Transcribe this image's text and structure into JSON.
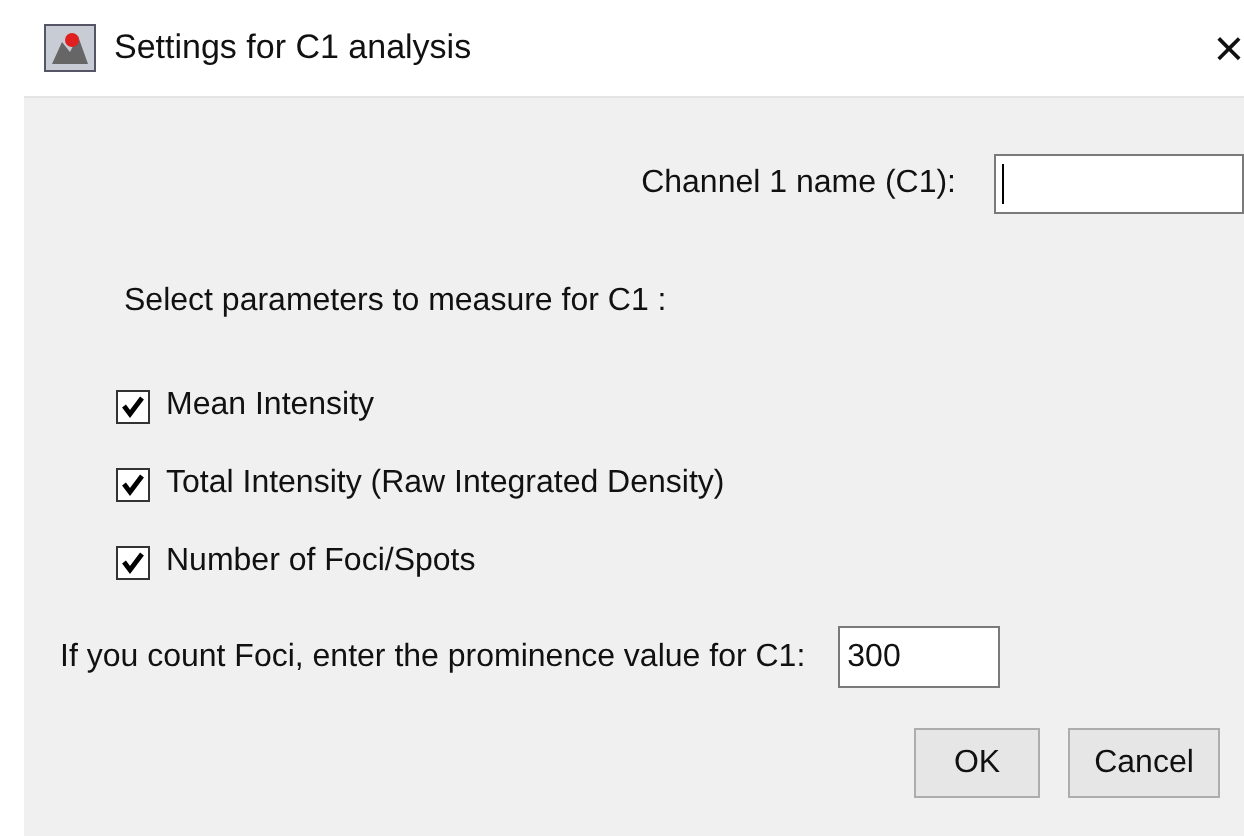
{
  "window": {
    "title": "Settings for C1 analysis",
    "close": "×"
  },
  "channel_name": {
    "label": "Channel 1 name (C1):"
  },
  "section_label": "Select parameters to measure for C1 :",
  "parameters": [
    {
      "label": "Mean Intensity",
      "checked": true
    },
    {
      "label": "Total Intensity (Raw Integrated Density)",
      "checked": true
    },
    {
      "label": "Number of Foci/Spots",
      "checked": true
    }
  ],
  "prominence": {
    "label": "If you count Foci, enter the prominence value for C1:",
    "value": "300"
  },
  "buttons": [
    "OK",
    "Cancel"
  ]
}
